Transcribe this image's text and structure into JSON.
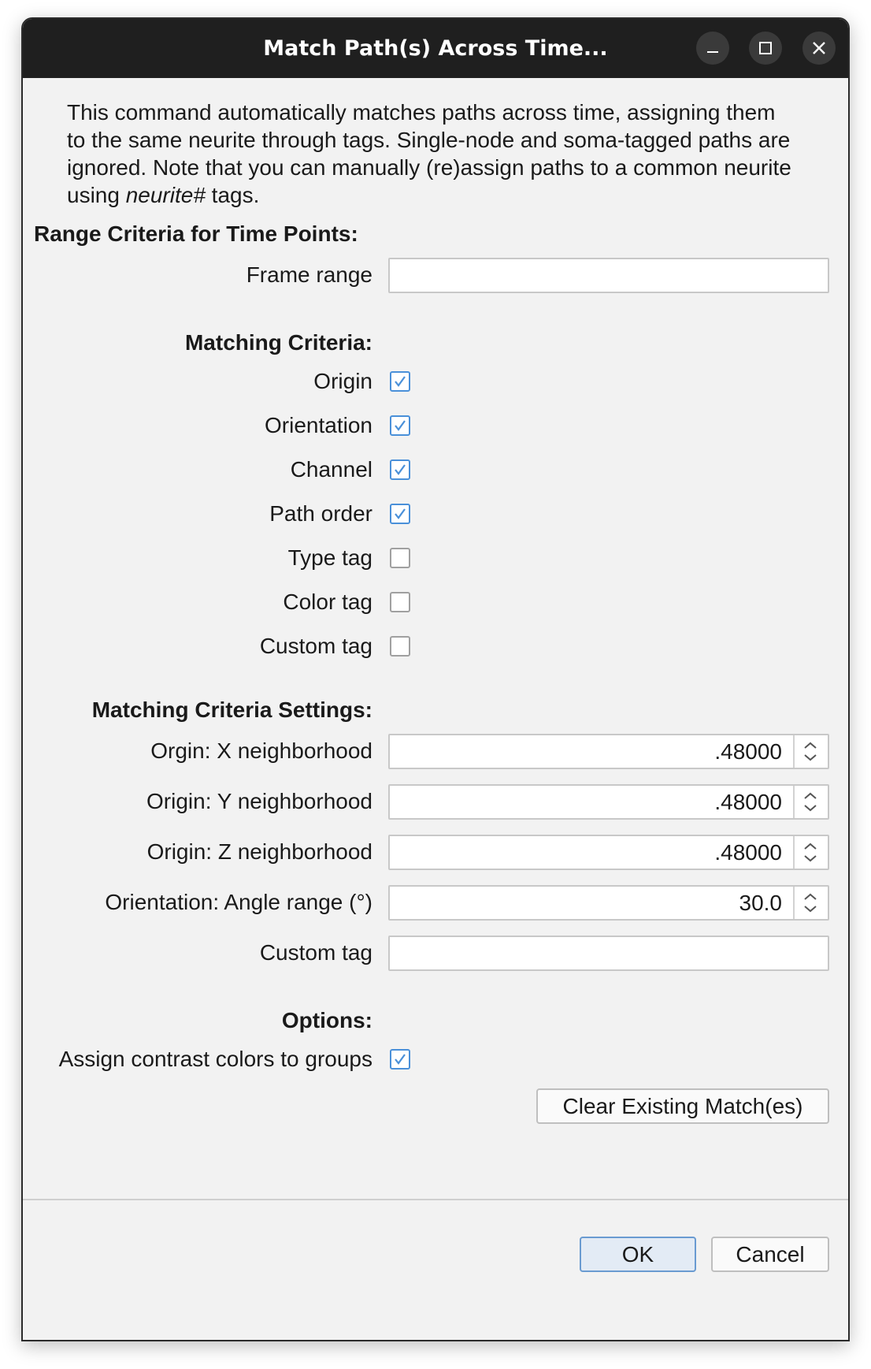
{
  "window": {
    "title": "Match Path(s) Across Time..."
  },
  "intro": {
    "line1": "This command automatically matches paths across time, assigning them",
    "line2": "to the same neurite through tags. Single-node and soma-tagged paths are",
    "line3": "ignored. Note that you can manually (re)assign paths to a common neurite",
    "line4_pre": "using ",
    "line4_em": "neurite#",
    "line4_post": " tags."
  },
  "range": {
    "heading": "Range Criteria for Time Points:",
    "frame_label": "Frame range",
    "frame_value": ""
  },
  "criteria": {
    "heading": "Matching Criteria:",
    "items": [
      {
        "label": "Origin",
        "checked": true
      },
      {
        "label": "Orientation",
        "checked": true
      },
      {
        "label": "Channel",
        "checked": true
      },
      {
        "label": "Path order",
        "checked": true
      },
      {
        "label": "Type tag",
        "checked": false
      },
      {
        "label": "Color tag",
        "checked": false
      },
      {
        "label": "Custom tag",
        "checked": false
      }
    ]
  },
  "settings": {
    "heading": "Matching Criteria Settings:",
    "x_label": "Orgin: X neighborhood",
    "x_value": ".48000",
    "y_label": "Origin: Y neighborhood",
    "y_value": ".48000",
    "z_label": "Origin: Z neighborhood",
    "z_value": ".48000",
    "angle_label": "Orientation: Angle range (°)",
    "angle_value": "30.0",
    "custom_label": "Custom tag",
    "custom_value": ""
  },
  "options": {
    "heading": "Options:",
    "contrast_label": "Assign contrast colors to groups",
    "contrast_checked": true
  },
  "buttons": {
    "clear": "Clear Existing Match(es)",
    "ok": "OK",
    "cancel": "Cancel"
  },
  "colors": {
    "accent": "#4a90d9",
    "titlebar": "#1f1f1f"
  }
}
